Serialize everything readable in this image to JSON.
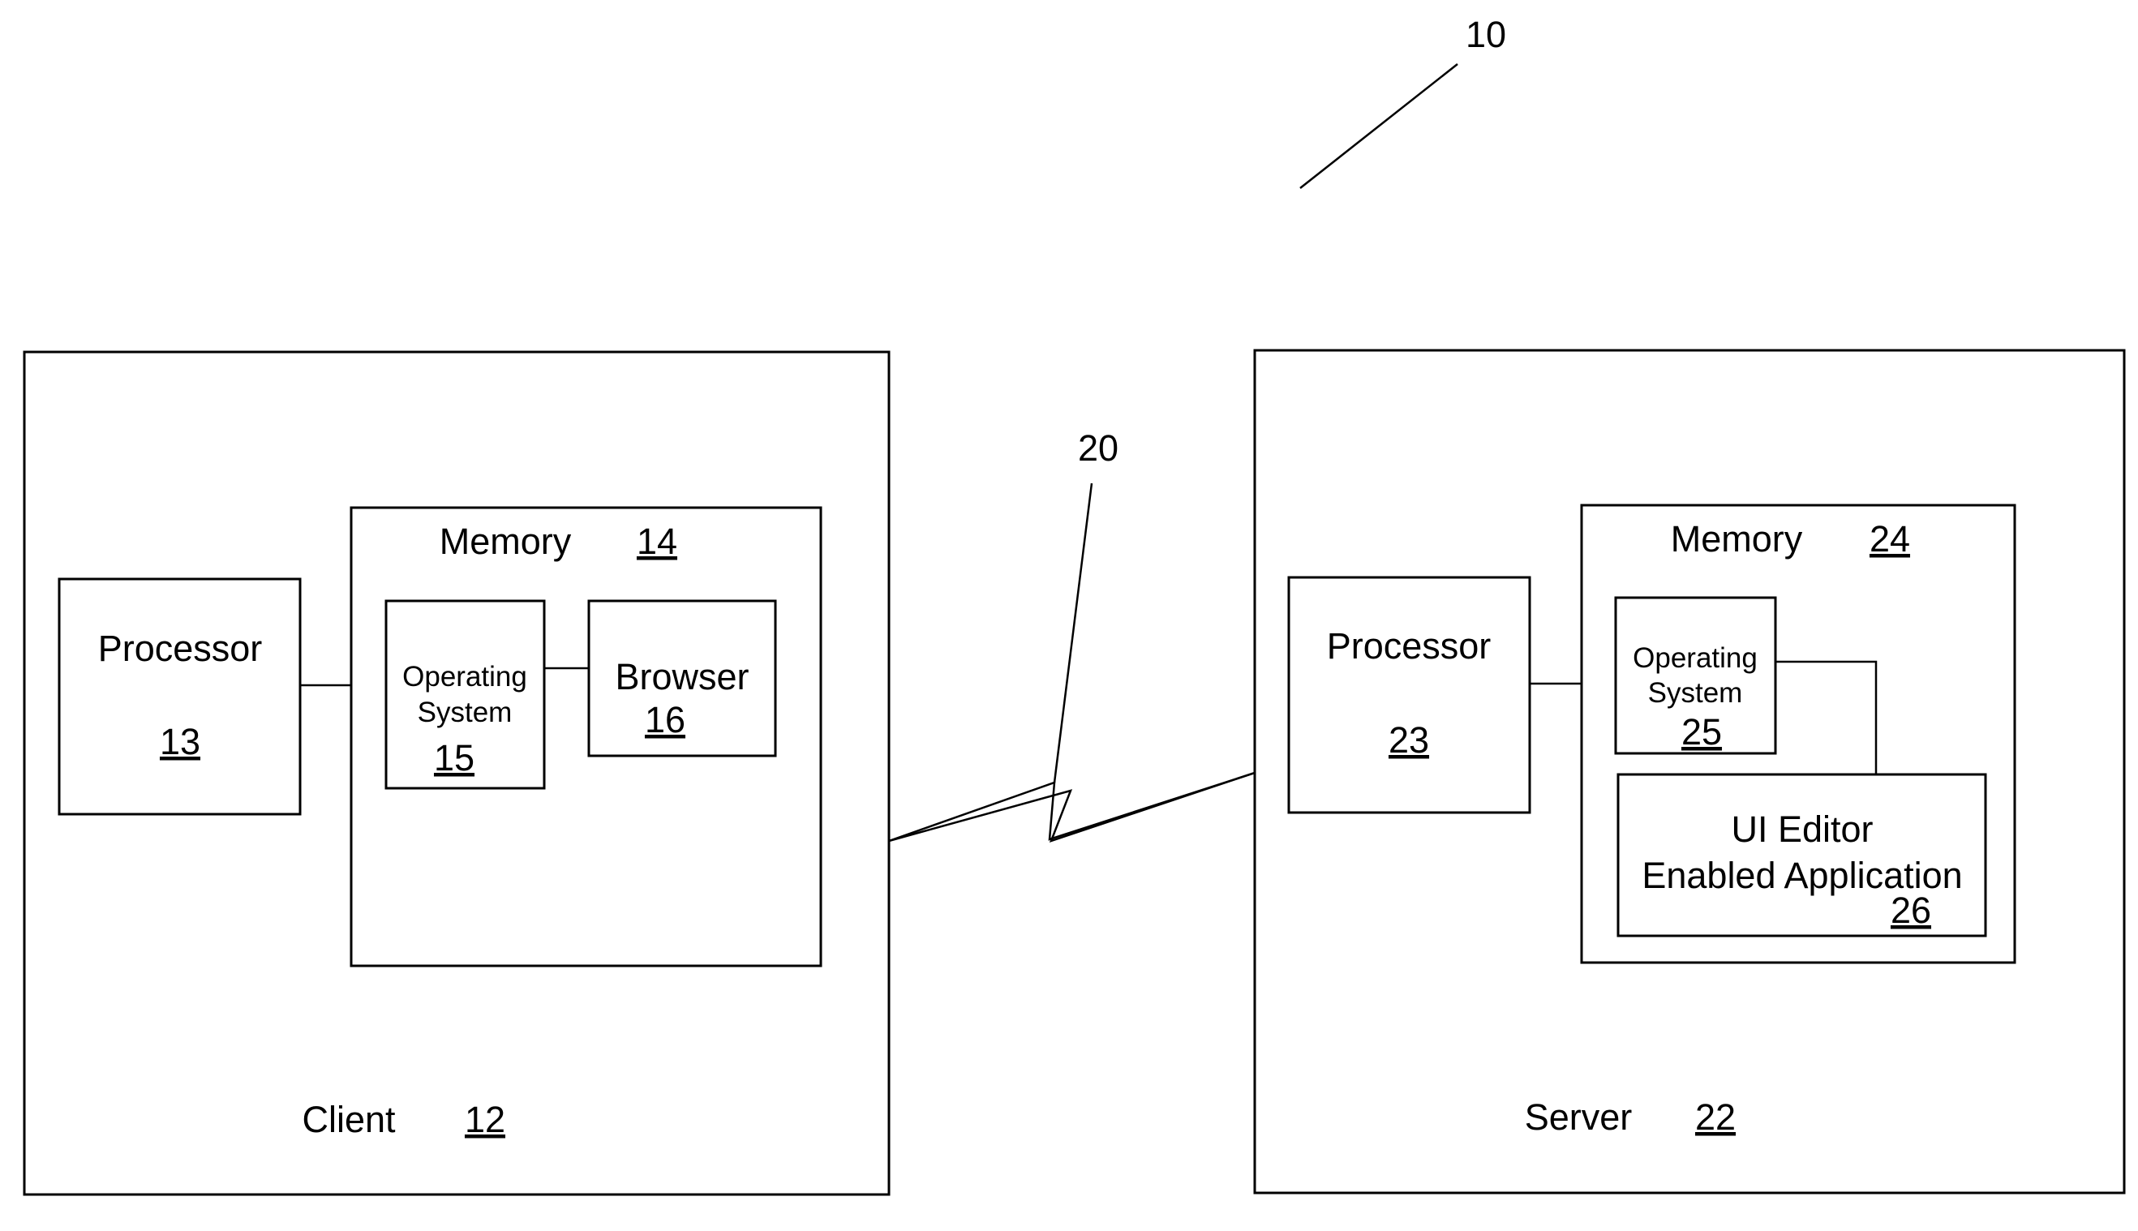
{
  "figure_ref": "10",
  "network": {
    "ref": "20"
  },
  "client": {
    "label": "Client",
    "ref": "12",
    "processor": {
      "label": "Processor",
      "ref": "13"
    },
    "memory": {
      "label": "Memory",
      "ref": "14"
    },
    "os": {
      "line1": "Operating",
      "line2": "System",
      "ref": "15"
    },
    "browser": {
      "label": "Browser",
      "ref": "16"
    }
  },
  "server": {
    "label": "Server",
    "ref": "22",
    "processor": {
      "label": "Processor",
      "ref": "23"
    },
    "memory": {
      "label": "Memory",
      "ref": "24"
    },
    "os": {
      "line1": "Operating",
      "line2": "System",
      "ref": "25"
    },
    "app": {
      "line1": "UI Editor",
      "line2": "Enabled Application",
      "ref": "26"
    }
  }
}
